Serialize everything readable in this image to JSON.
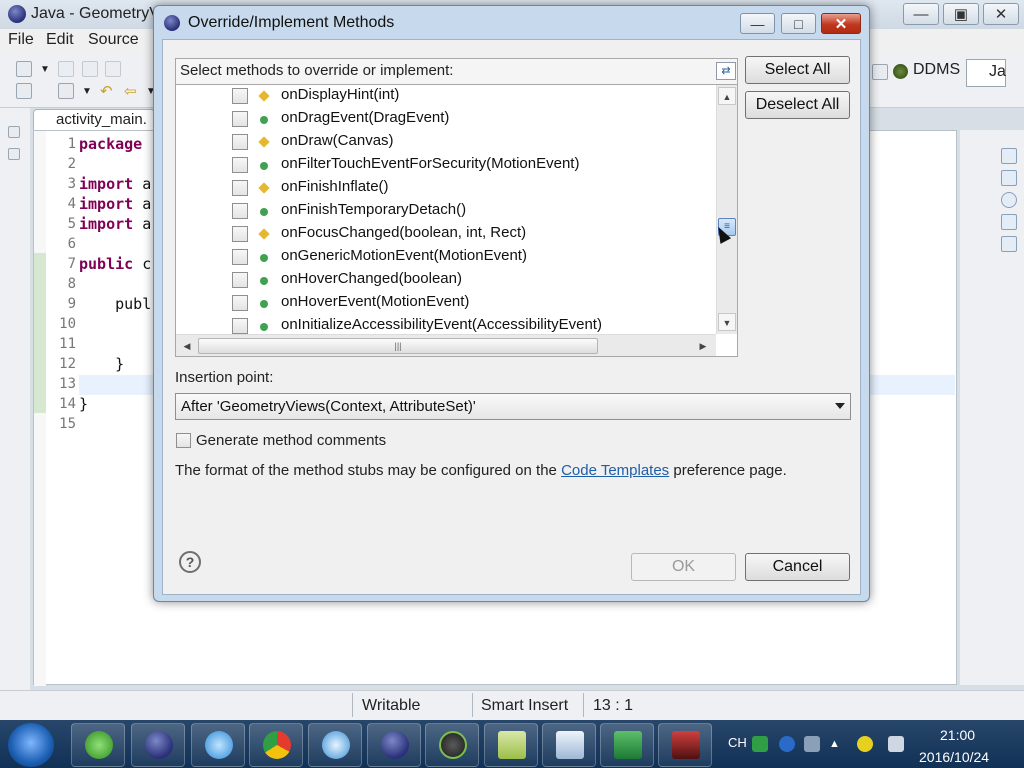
{
  "main_window": {
    "title": "Java - GeometryV",
    "menu": [
      "File",
      "Edit",
      "Source"
    ],
    "perspectives": {
      "ddms": "DDMS",
      "java": "Ja"
    }
  },
  "editor": {
    "tab_label": "activity_main.",
    "line_numbers": [
      "1",
      "2",
      "3",
      "4",
      "5",
      "6",
      "7",
      "8",
      "9",
      "10",
      "11",
      "12",
      "13",
      "14",
      "15"
    ],
    "code_lines": [
      {
        "kw": "package",
        "rest": " "
      },
      {
        "kw": "",
        "rest": ""
      },
      {
        "kw": "import",
        "rest": " a"
      },
      {
        "kw": "import",
        "rest": " a"
      },
      {
        "kw": "import",
        "rest": " a"
      },
      {
        "kw": "",
        "rest": ""
      },
      {
        "kw": "public",
        "rest": " c"
      },
      {
        "kw": "",
        "rest": ""
      },
      {
        "kw": "",
        "rest": "    publ"
      },
      {
        "kw": "",
        "rest": ""
      },
      {
        "kw": "",
        "rest": ""
      },
      {
        "kw": "",
        "rest": "    }"
      },
      {
        "kw": "",
        "rest": ""
      },
      {
        "kw": "",
        "rest": "}"
      },
      {
        "kw": "",
        "rest": ""
      }
    ]
  },
  "status": {
    "writable": "Writable",
    "insert_mode": "Smart Insert",
    "position": "13 : 1"
  },
  "taskbar": {
    "lang": "CH",
    "time": "21:00",
    "date": "2016/10/24"
  },
  "dialog": {
    "title": "Override/Implement Methods",
    "list_header": "Select methods to override or implement:",
    "methods": [
      {
        "name": "onDisplayHint(int)",
        "marker": "diamond"
      },
      {
        "name": "onDragEvent(DragEvent)",
        "marker": "dot"
      },
      {
        "name": "onDraw(Canvas)",
        "marker": "diamond"
      },
      {
        "name": "onFilterTouchEventForSecurity(MotionEvent)",
        "marker": "dot"
      },
      {
        "name": "onFinishInflate()",
        "marker": "diamond"
      },
      {
        "name": "onFinishTemporaryDetach()",
        "marker": "dot"
      },
      {
        "name": "onFocusChanged(boolean, int, Rect)",
        "marker": "diamond"
      },
      {
        "name": "onGenericMotionEvent(MotionEvent)",
        "marker": "dot"
      },
      {
        "name": "onHoverChanged(boolean)",
        "marker": "dot"
      },
      {
        "name": "onHoverEvent(MotionEvent)",
        "marker": "dot"
      },
      {
        "name": "onInitializeAccessibilityEvent(AccessibilityEvent)",
        "marker": "dot"
      }
    ],
    "select_all": "Select All",
    "deselect_all": "Deselect All",
    "insertion_label": "Insertion point:",
    "insertion_value": "After 'GeometryViews(Context, AttributeSet)'",
    "generate_comments_label": "Generate method comments",
    "generate_comments_checked": false,
    "format_note_before": "The format of the method stubs may be configured on the ",
    "format_note_link": "Code Templates",
    "format_note_after": " preference page.",
    "ok": "OK",
    "cancel": "Cancel",
    "colors": {
      "dot": "#3fa24f",
      "diamond": "#e6b830",
      "link": "#1f5ea8"
    }
  }
}
